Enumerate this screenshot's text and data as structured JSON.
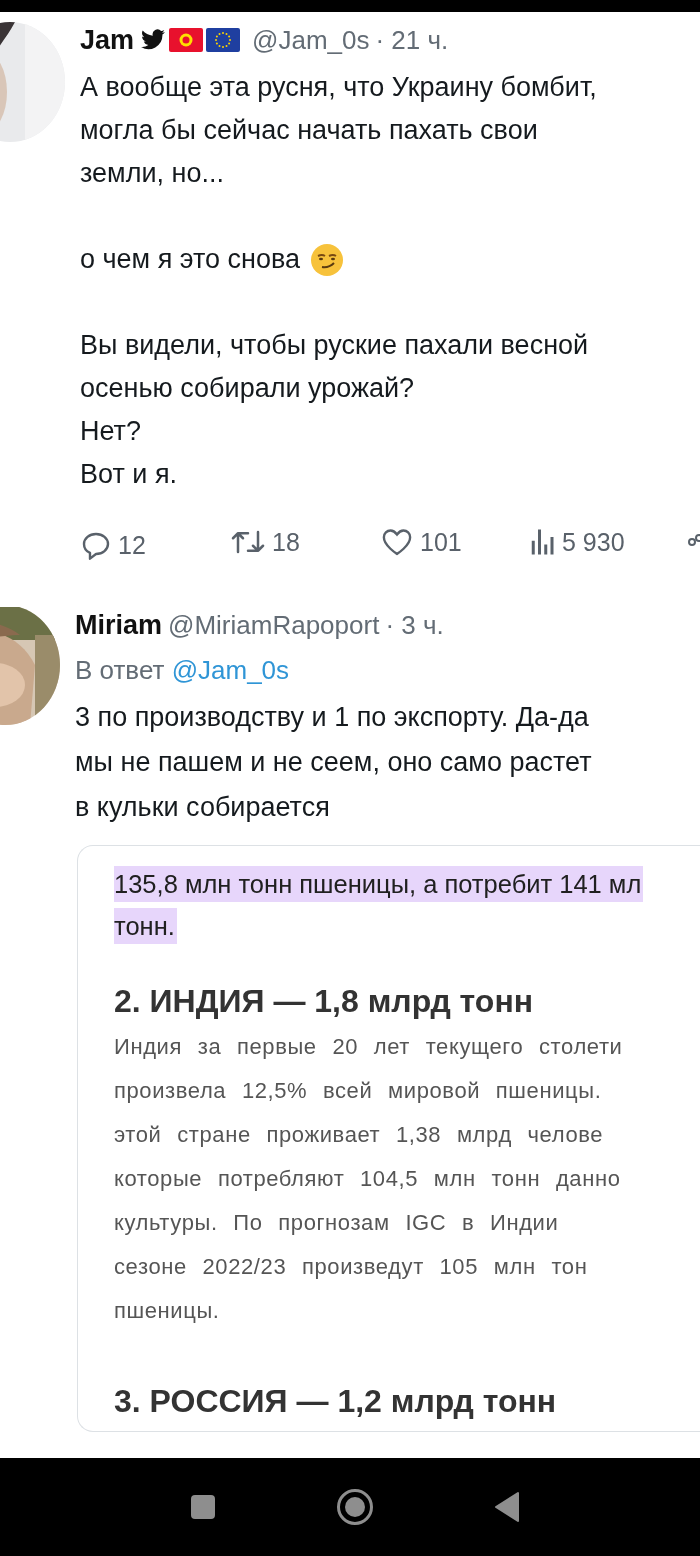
{
  "tweets": [
    {
      "author": "Jam",
      "name_icons": [
        {
          "kind": "bird"
        },
        {
          "kind": "flag-kg"
        },
        {
          "kind": "flag-eu"
        }
      ],
      "handle": "@Jam_0s",
      "time": "· 21 ч.",
      "avatar": {
        "kind": "picture"
      },
      "paragraphs": [
        {
          "lines": [
            {
              "text": "А вообще эта русня, что Украину бомбит,"
            },
            {
              "text": "могла бы сейчас начать пахать свои"
            },
            {
              "text": "земли, но..."
            }
          ]
        },
        {
          "lines": [
            {
              "text": "о чем я это снова",
              "has_emoji": true
            }
          ]
        },
        {
          "lines": [
            {
              "text": "Вы видели, чтобы руские пахали весной"
            },
            {
              "text": "осенью собирали урожай?"
            },
            {
              "text": "Нет?"
            },
            {
              "text": "Вот и я."
            }
          ]
        }
      ],
      "stats": [
        {
          "kind": "reply",
          "count": "12"
        },
        {
          "kind": "retweet",
          "count": "18"
        },
        {
          "kind": "like",
          "count": "101"
        },
        {
          "kind": "views",
          "count": "5 930"
        },
        {
          "kind": "share"
        }
      ]
    },
    {
      "author": "Miriam",
      "handle": "@MiriamRapoport",
      "time": "· 3 ч.",
      "avatar": {
        "kind": "picture"
      },
      "reply_to": {
        "prefix": "В ответ",
        "handle": "@Jam_0s"
      },
      "paragraphs": [
        {
          "lines": [
            {
              "text": "3 по производству и 1 по экспорту. Да-да"
            },
            {
              "text": "мы не пашем и не сеем, оно само растет"
            },
            {
              "text": "в кульки собирается"
            }
          ]
        }
      ],
      "media": {
        "kind": "article",
        "blocks": [
          {
            "kind": "highlight",
            "lines": [
              "135,8 млн тонн пшеницы, а потребит 141 мл",
              "тонн."
            ]
          },
          {
            "kind": "heading",
            "text": "2. ИНДИЯ — 1,8 млрд тонн"
          },
          {
            "kind": "paragraph",
            "lines": [
              "Индия за первые 20 лет текущего столети",
              "произвела 12,5% всей мировой пшеницы.",
              "этой стране проживает 1,38 млрд челове",
              "которые потребляют 104,5 млн тонн данно",
              "культуры. По прогнозам IGC в Индии",
              "сезоне 2022/23 произведут 105 млн тон",
              "пшеницы."
            ]
          },
          {
            "kind": "heading",
            "text": "3. РОССИЯ — 1,2 млрд тонн"
          }
        ]
      }
    }
  ],
  "nav_bar": {
    "buttons": [
      {
        "kind": "recents"
      },
      {
        "kind": "home"
      },
      {
        "kind": "back"
      }
    ]
  }
}
